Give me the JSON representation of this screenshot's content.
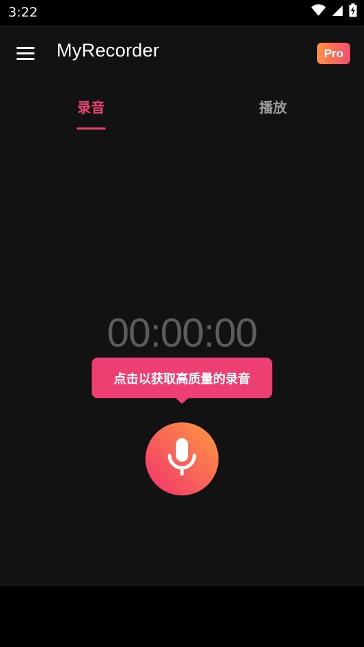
{
  "status_bar": {
    "time": "3:22",
    "icons": [
      "wifi-icon",
      "signal-icon",
      "battery-charging-icon"
    ]
  },
  "app_bar": {
    "title": "MyRecorder",
    "menu_icon": "menu-icon",
    "pro_label": "Pro"
  },
  "tabs": [
    {
      "label": "录音",
      "active": true
    },
    {
      "label": "播放",
      "active": false
    }
  ],
  "recorder": {
    "timer": "00:00:00",
    "tooltip": "点击以获取高质量的录音",
    "mic_icon": "microphone-icon"
  },
  "colors": {
    "accent": "#ec4470",
    "background": "#121212",
    "gradient_start": "#fc9c3f",
    "gradient_end": "#f2306f"
  }
}
